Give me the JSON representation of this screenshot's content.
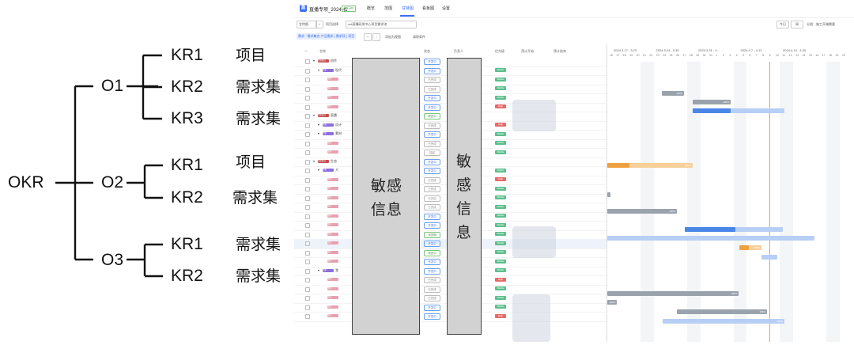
{
  "okr": {
    "root": "OKR",
    "objectives": [
      {
        "label": "O1",
        "krs": [
          {
            "label": "KR1",
            "type": "项目"
          },
          {
            "label": "KR2",
            "type": "需求集"
          },
          {
            "label": "KR3",
            "type": "需求集"
          }
        ]
      },
      {
        "label": "O2",
        "krs": [
          {
            "label": "KR1",
            "type": "项目"
          },
          {
            "label": "KR2",
            "type": "需求集"
          }
        ]
      },
      {
        "label": "O3",
        "krs": [
          {
            "label": "KR1",
            "type": "需求集"
          },
          {
            "label": "KR2",
            "type": "需求集"
          }
        ]
      }
    ]
  },
  "app": {
    "logo": "直",
    "project_title": "直播专项_2024H1",
    "project_tag": "进行中",
    "nav": [
      "概览",
      "范围",
      "甘特图",
      "看板图",
      "设置"
    ],
    "active_nav": "甘特图",
    "toolbar": {
      "view_select": "甘特图",
      "filter_label": "项目选择",
      "filter_value": "odi直播研发中心项目需求池",
      "today_btn": "今日",
      "unit_btn": "周",
      "mode_label": "分组：施工开端需要"
    },
    "filter_chip": "需求 · 需求集合  产品需求 | 需求项 | 项目",
    "filter_links": [
      "添加为视图",
      "清除条件"
    ],
    "columns": [
      "名称",
      "状态",
      "负责人",
      "优先级",
      "预计开始",
      "预计结束"
    ],
    "mask_left": "敏感信息",
    "mask_right": "敏感信息",
    "rows": [
      {
        "tag": "需求集合",
        "tagc": "#c94d4d",
        "name": "创作",
        "status": "开发中",
        "pri": "",
        "depth": 0
      },
      {
        "tag": "需求",
        "tagc": "#8c6fd9",
        "name": "现代",
        "status": "开发中",
        "pri": "Middle",
        "depth": 1
      },
      {
        "tag": "需求",
        "tagc": "#e8a0b0",
        "name": "",
        "status": "已完成",
        "pri": "Middle",
        "depth": 2
      },
      {
        "tag": "需求",
        "tagc": "#e8a0b0",
        "name": "",
        "status": "已完成",
        "pri": "Middle",
        "depth": 2
      },
      {
        "tag": "需求",
        "tagc": "#e8a0b0",
        "name": "",
        "status": "开发中",
        "pri": "Middle",
        "depth": 2
      },
      {
        "tag": "需求",
        "tagc": "#e8a0b0",
        "name": "",
        "status": "开发中",
        "pri": "High",
        "depth": 2
      },
      {
        "tag": "需求集合",
        "tagc": "#c94d4d",
        "name": "直播",
        "status": "规划中",
        "pri": "",
        "depth": 0
      },
      {
        "tag": "需求",
        "tagc": "#8c6fd9",
        "name": "设计",
        "status": "已完成",
        "pri": "High",
        "depth": 1
      },
      {
        "tag": "需求",
        "tagc": "#8c6fd9",
        "name": "素材",
        "status": "开发中",
        "pri": "Middle",
        "depth": 1
      },
      {
        "tag": "需求",
        "tagc": "#e8a0b0",
        "name": "",
        "status": "已完成",
        "pri": "Middle",
        "depth": 2
      },
      {
        "tag": "需求",
        "tagc": "#e8a0b0",
        "name": "",
        "status": "挂起",
        "pri": "Middle",
        "depth": 2
      },
      {
        "tag": "需求集合",
        "tagc": "#c94d4d",
        "name": "生态",
        "status": "开发中",
        "pri": "",
        "depth": 0
      },
      {
        "tag": "需求",
        "tagc": "#8c6fd9",
        "name": "大",
        "status": "开发中",
        "pri": "Middle",
        "depth": 1
      },
      {
        "tag": "需求",
        "tagc": "#e8a0b0",
        "name": "",
        "status": "已完成",
        "pri": "High",
        "depth": 2
      },
      {
        "tag": "需求",
        "tagc": "#e8a0b0",
        "name": "",
        "status": "已完成",
        "pri": "Middle",
        "depth": 2
      },
      {
        "tag": "需求",
        "tagc": "#e8a0b0",
        "name": "",
        "status": "已评估",
        "pri": "Middle",
        "depth": 2
      },
      {
        "tag": "需求",
        "tagc": "#e8a0b0",
        "name": "",
        "status": "已完成",
        "pri": "Middle",
        "depth": 2
      },
      {
        "tag": "需求",
        "tagc": "#e8a0b0",
        "name": "",
        "status": "开发中",
        "pri": "Middle",
        "depth": 2
      },
      {
        "tag": "需求",
        "tagc": "#e8a0b0",
        "name": "",
        "status": "开发中",
        "pri": "Middle",
        "depth": 2
      },
      {
        "tag": "需求",
        "tagc": "#e8a0b0",
        "name": "",
        "status": "待排期",
        "pri": "Middle",
        "depth": 2
      },
      {
        "tag": "需求",
        "tagc": "#e8a0b0",
        "name": "",
        "status": "开发中",
        "pri": "Middle",
        "depth": 2
      },
      {
        "tag": "需求",
        "tagc": "#e8a0b0",
        "name": "",
        "status": "规划中",
        "pri": "Middle",
        "depth": 2
      },
      {
        "tag": "需求",
        "tagc": "#e8a0b0",
        "name": "",
        "status": "开发中",
        "pri": "Middle",
        "depth": 2
      },
      {
        "tag": "需求",
        "tagc": "#8c6fd9",
        "name": "我",
        "status": "开发中",
        "pri": "Middle",
        "depth": 1
      },
      {
        "tag": "需求",
        "tagc": "#e8a0b0",
        "name": "",
        "status": "已完成",
        "pri": "High",
        "depth": 2
      },
      {
        "tag": "需求",
        "tagc": "#e8a0b0",
        "name": "",
        "status": "已完成",
        "pri": "Middle",
        "depth": 2
      },
      {
        "tag": "需求",
        "tagc": "#e8a0b0",
        "name": "",
        "status": "已完成",
        "pri": "Middle",
        "depth": 2
      },
      {
        "tag": "需求",
        "tagc": "#e8a0b0",
        "name": "",
        "status": "开发中",
        "pri": "Middle",
        "depth": 2
      },
      {
        "tag": "需求",
        "tagc": "#e8a0b0",
        "name": "",
        "status": "开发中",
        "pri": "High",
        "depth": 2
      }
    ],
    "gantt": {
      "weeks": [
        "2024.3.17 - 3.23",
        "2024.3.24 - 3.30",
        "2024.3.31 - 4...",
        "2024.4.7 - 4.13",
        "2024.4.14 - 4.20"
      ],
      "days": [
        "16",
        "17",
        "18",
        "19",
        "20",
        "21",
        "22",
        "23",
        "24",
        "25",
        "26",
        "27",
        "28",
        "29",
        "30",
        "31",
        "1",
        "2",
        "3",
        "4",
        "5",
        "6",
        "7",
        "8",
        "9",
        "10",
        "11",
        "12",
        "13",
        "14",
        "15",
        "16",
        "17",
        "18",
        "19",
        "20"
      ],
      "pct_labels": [
        "100%",
        "100%",
        "100%",
        "100%",
        "100%",
        "100%",
        "100%",
        "100%",
        "100%",
        "100%",
        "100%"
      ],
      "colors": {
        "done": "#9aa3ad",
        "progress": "#4a86e8",
        "plan": "#b7cff5",
        "warn": "#f0a040",
        "warn_light": "#f7cf99",
        "today": "#f0a040"
      }
    }
  }
}
